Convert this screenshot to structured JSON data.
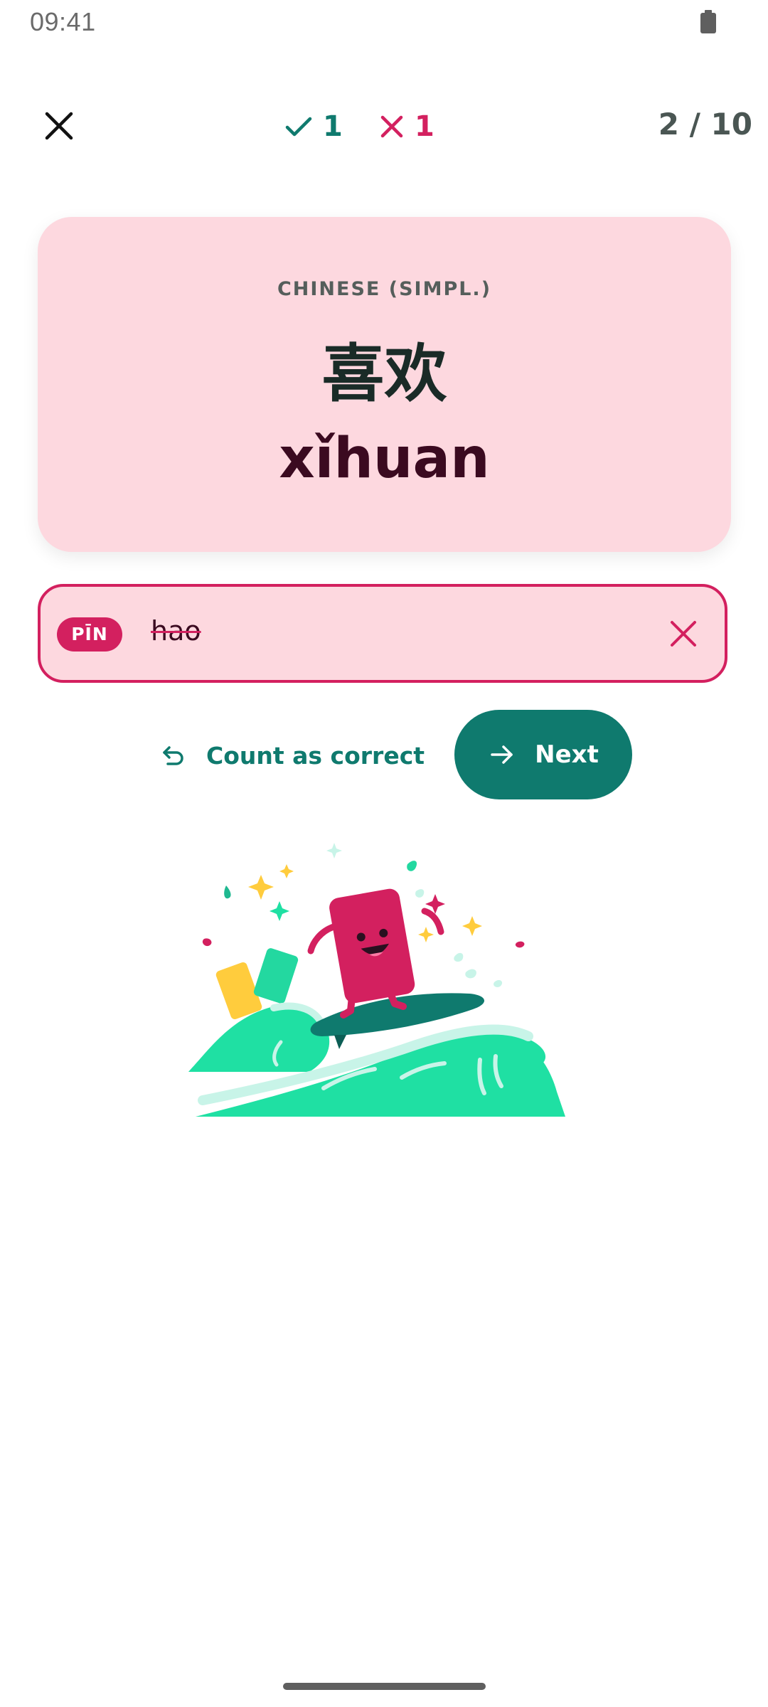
{
  "status_bar": {
    "time": "09:41",
    "battery_icon": "battery-full-icon"
  },
  "top_bar": {
    "close_icon": "close-icon",
    "correct_count": "1",
    "wrong_count": "1",
    "progress": "2 / 10"
  },
  "card": {
    "language": "CHINESE (SIMPL.)",
    "term": "喜欢",
    "reading": "xǐhuan"
  },
  "answer": {
    "tag": "PĪN",
    "value": "hao",
    "result": "incorrect"
  },
  "actions": {
    "override_label": "Count as correct",
    "next_label": "Next"
  },
  "illustration": {
    "name": "surfing-flashcard-mascot"
  },
  "colors": {
    "accent_teal": "#0f7a6e",
    "error_pink": "#d3205f",
    "card_background": "#fdd8df",
    "wave_green": "#1fe0a3"
  }
}
